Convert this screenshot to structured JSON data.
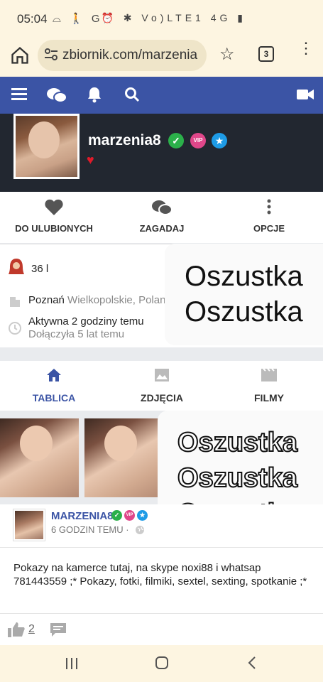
{
  "status_bar": {
    "time": "05:04",
    "left_icons": "⌓ 🚶 G •",
    "right_icons": "⏰ ✱ Vo)LTE1 4G ▮"
  },
  "browser": {
    "url": "zbiornik.com/marzenia",
    "tab_count": "3"
  },
  "profile": {
    "username": "marzenia8",
    "badges": {
      "vip": "VIP"
    }
  },
  "actions": [
    {
      "label": "DO ULUBIONYCH",
      "icon": "heart-icon"
    },
    {
      "label": "ZAGADAJ",
      "icon": "chat-icon"
    },
    {
      "label": "OPCJE",
      "icon": "more-vertical-icon"
    }
  ],
  "info": {
    "age": "36 l",
    "city": "Poznań",
    "region": "Wielkopolskie, Polan",
    "active": "Aktywna 2 godziny temu",
    "joined": "Dołączyła 5 lat temu"
  },
  "overlay_top": [
    "Oszustka",
    "Oszustka"
  ],
  "tabs": [
    {
      "label": "TABLICA",
      "icon": "home-icon",
      "active": true
    },
    {
      "label": "ZDJĘCIA",
      "icon": "image-icon",
      "active": false
    },
    {
      "label": "FILMY",
      "icon": "film-icon",
      "active": false
    }
  ],
  "overlay_bottom": [
    "Oszustka",
    "Oszustka",
    "Oszustka"
  ],
  "post": {
    "user": "MARZENIA8",
    "time": "6 GODZIN TEMU ·",
    "vip": "VIP",
    "text": "Pokazy na kamerce tutaj, na skype noxi88 i whatsap 781443559 ;* Pokazy, fotki, filmiki, sextel, sexting, spotkanie ;*",
    "likes": "2"
  },
  "colors": {
    "nav_blue": "#3b54a5",
    "header_dark": "#222730",
    "browser_bg": "#fdf5e1"
  }
}
